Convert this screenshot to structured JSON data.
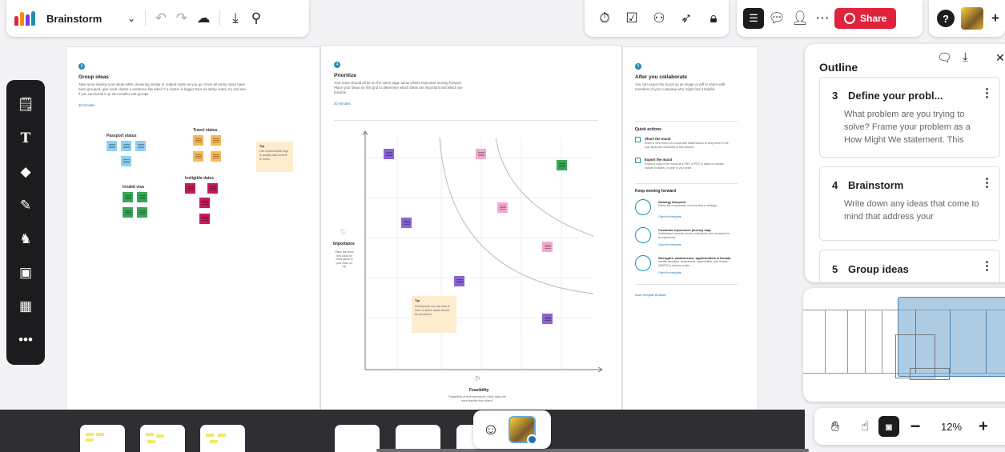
{
  "board": {
    "title": "Brainstorm",
    "share_label": "Share"
  },
  "sections": {
    "group": {
      "number": "3",
      "title": "Group ideas",
      "desc": "Take turns sharing your ideas while clustering similar or related notes as you go. Once all sticky notes have been grouped, give each cluster a sentence-like label. If a cluster is bigger than six sticky notes, try and see if you can break it up into smaller sub-groups.",
      "time": "20 minutes",
      "clusters": [
        "Passport status",
        "Travel status",
        "Invalid visa",
        "Ineligible dates"
      ],
      "tip_label": "Tip",
      "tip_text": "Use customizable tags to quickly add context to notes"
    },
    "prioritize": {
      "number": "4",
      "title": "Prioritize",
      "desc": "Your team should all be on the same page about what's important moving forward. Place your ideas on this grid to determine which ideas are important and which are feasible.",
      "time": "20 minutes",
      "y_axis": "Importance",
      "y_desc": "Place the ideas that could be most useful to your team on top",
      "x_axis": "Feasibility",
      "x_desc": "Regardless of their importance, which tasks are more feasible than others?",
      "tip_label": "Tip",
      "tip_text": "Participants can use dots to vote on which ideas should be prioritized"
    },
    "collaborate": {
      "number": "5",
      "title": "After you collaborate",
      "desc": "You can export the mural as an image or pdf to share with members of your company who might find it helpful.",
      "quick_title": "Quick actions",
      "actions": [
        {
          "title": "Share the mural",
          "desc": "Share a view link to the mural with stakeholders to keep them in the loop about the outcomes of this session."
        },
        {
          "title": "Export the mural",
          "desc": "Export a copy of the mural as a PNG or PDF to attach to emails, include in slides, or save in your drive."
        }
      ],
      "keep_title": "Keep moving forward",
      "templates": [
        {
          "title": "Strategy blueprint",
          "desc": "Define the components of a new idea or strategy.",
          "link": "Open the template"
        },
        {
          "title": "Customer experience journey map",
          "desc": "Understand customer needs, motivations, and obstacles for an experience.",
          "link": "Open the template"
        },
        {
          "title": "Strengths, weaknesses, opportunities & threats",
          "desc": "Identify strengths, weaknesses, opportunities, and threats (SWOT) to develop a plan.",
          "link": "Open the template"
        }
      ],
      "feedback": "Share template feedback"
    }
  },
  "outline": {
    "title": "Outline",
    "cards": [
      {
        "num": "3",
        "title": "Define your probl...",
        "desc": "What problem are you trying to solve? Frame your problem as a How Might We statement. This"
      },
      {
        "num": "4",
        "title": "Brainstorm",
        "desc": "Write down any ideas that come to mind that address your"
      },
      {
        "num": "5",
        "title": "Group ideas",
        "desc": ""
      }
    ]
  },
  "zoom": {
    "level": "12%",
    "minus": "−",
    "plus": "+"
  },
  "icons": {
    "undo": "undo-icon",
    "redo": "redo-icon",
    "cloud": "cloud-check-icon",
    "export": "export-icon",
    "search": "search-icon"
  },
  "colors": {
    "accent": "#e0233d",
    "blue_note": "#8fd0f0",
    "orange_note": "#f7b955",
    "green_note": "#3aa657",
    "magenta_note": "#c8195e",
    "purple_note": "#8b63d6",
    "pink_note": "#f4a9cc",
    "teal": "#1d8fb0"
  }
}
